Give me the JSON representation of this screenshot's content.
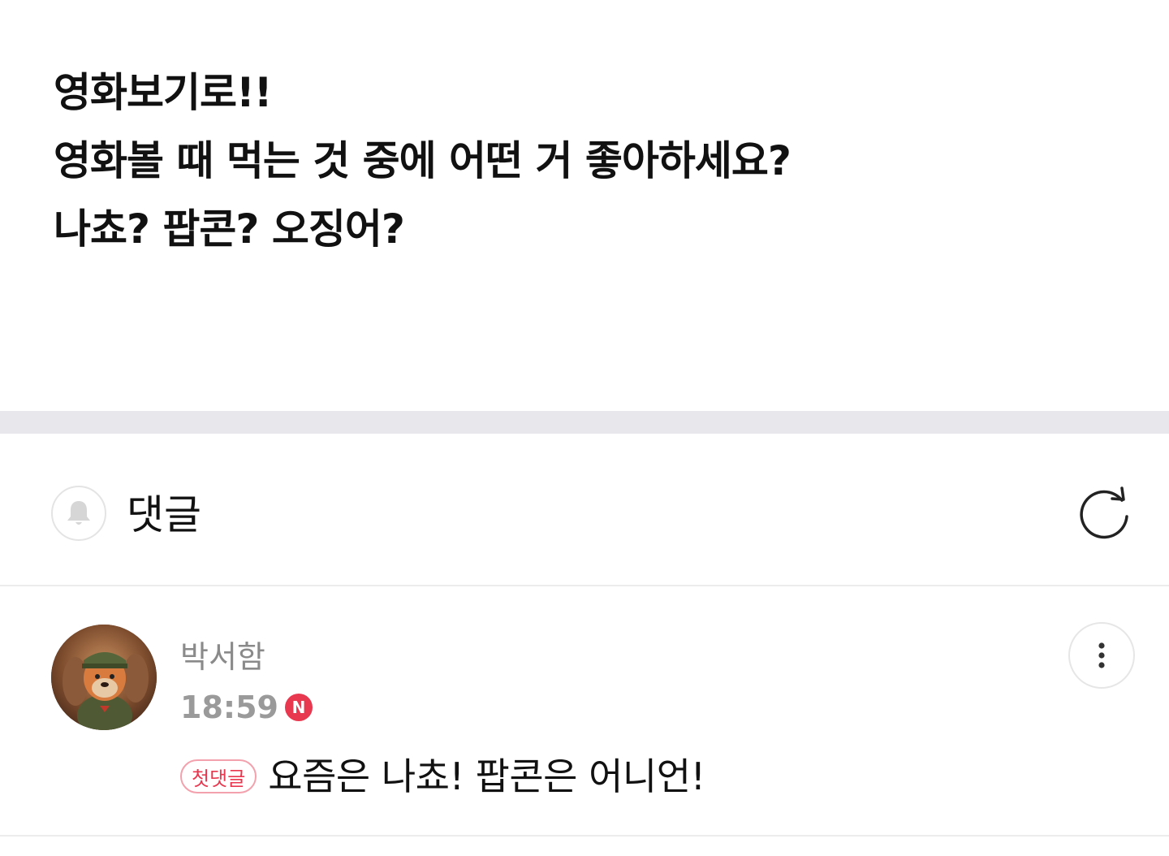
{
  "post": {
    "lines": [
      "영화보기로!!",
      "영화볼 때 먹는 것 중에 어떤 거 좋아하세요?",
      "나쵸? 팝콘? 오징어?"
    ]
  },
  "comments_header": {
    "title": "댓글",
    "bell_icon": "bell-icon",
    "refresh_icon": "refresh-icon"
  },
  "comment": {
    "author": "박서함",
    "time": "18:59",
    "new_badge": "N",
    "first_badge": "첫댓글",
    "text": "요즘은 나쵸! 팝콘은 어니언!",
    "more_icon": "more-vertical-icon"
  },
  "colors": {
    "accent": "#e8384f",
    "divider": "#e8e8ec",
    "muted_text": "#8a8a8a"
  }
}
